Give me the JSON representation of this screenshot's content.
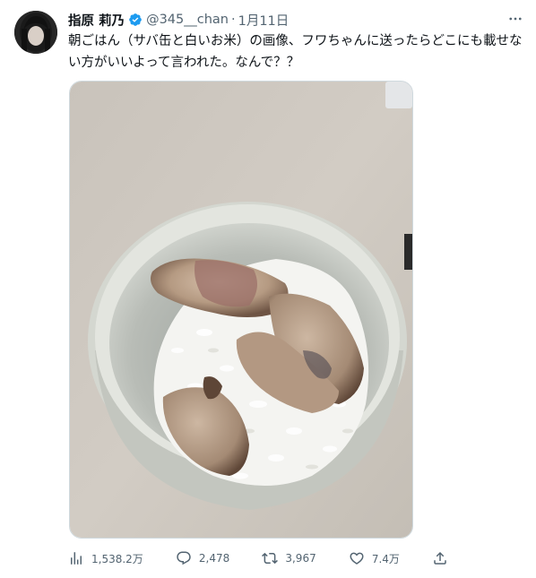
{
  "author": {
    "name": "指原 莉乃",
    "handle": "@345__chan",
    "separator": "·",
    "date": "1月11日"
  },
  "tweet": {
    "text": "朝ごはん（サバ缶と白いお米）の画像、フワちゃんに送ったらどこにも載せない方がいいよって言われた。なんで？？"
  },
  "media": {
    "alt": ""
  },
  "actions": {
    "views": "1,538.2万",
    "replies": "2,478",
    "retweets": "3,967",
    "likes": "7.4万"
  },
  "colors": {
    "text": "#0f1419",
    "muted": "#536471",
    "verified": "#1d9bf0"
  },
  "icons": [
    "more-icon",
    "verified-badge-icon",
    "views-icon",
    "reply-icon",
    "retweet-icon",
    "like-icon",
    "share-icon"
  ]
}
